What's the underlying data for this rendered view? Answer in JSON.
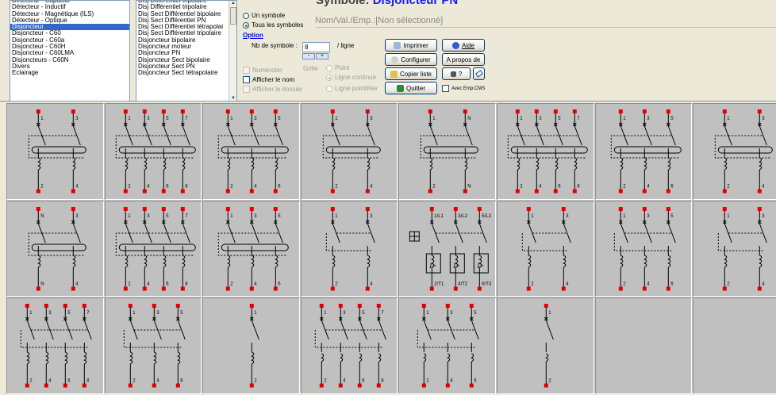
{
  "list1": {
    "items": [
      "Détecteur - Capacitif",
      "Détecteur - Inductif",
      "Détecteur - Magnétique (ILS)",
      "Détecteur - Optique",
      "Disjoncteur",
      "Disjoncteur - C60",
      "Disjoncteur - C60a",
      "Disjoncteur - C60H",
      "Disjoncteur - C60LMA",
      "Disjoncteurs - C60N",
      "Divers",
      "Eclairage"
    ],
    "selected_index": 4
  },
  "list2": {
    "items": [
      "Disj Différentiel tripolaire",
      "Disj Différentiel tripolaire",
      "Disj Sect Différentiel bipolaire",
      "Disj Sect Différentiel PN",
      "Disj Sect Différentiel tétrapolai",
      "Disj Sect Différentiel tripolaire",
      "Disjoncteur bipolaire",
      "Disjoncteur moteur",
      "Disjoncteur PN",
      "Disjoncteur Sect bipolaire",
      "Disjoncteur Sect PN",
      "Disjoncteur Sect tétrapolaire"
    ]
  },
  "mode": {
    "un_symbole": "Un symbole",
    "tous_symboles": "Tous les symboles"
  },
  "option": {
    "label": "Option",
    "nb_label": "Nb de symbole :",
    "nb_value": "8",
    "per_line": "/ ligne",
    "spin_down": "-",
    "spin_up": "+"
  },
  "checks": {
    "numeroter": "Numéroter",
    "afficher_nom": "Afficher le nom",
    "afficher_dossier": "Afficher le dossier",
    "avec_emp": "Avec Emp.CMS"
  },
  "grille": {
    "label": "Grille",
    "point": "Point",
    "ligne_continue": "Ligne continue",
    "ligne_pointillee": "Ligne pointillée"
  },
  "buttons": {
    "imprimer": "Imprimer",
    "configurer": "Configurer",
    "copier": "Copier liste",
    "quitter": "Quitter",
    "aide": "Aide",
    "apropos": "A propos de",
    "help_q": "?"
  },
  "header": {
    "symbole_label": "Symbole:",
    "symbole_value": "Disjoncteur PN",
    "nomval": "Nom/Val./Emp.:[Non sélectionné]"
  },
  "colors": {
    "selection": "#3169c6",
    "terminal": "#e00000",
    "title_value": "#1a1aff"
  },
  "symbols": [
    {
      "poles": 2,
      "labels_top": [
        "1",
        "3"
      ],
      "labels_bot": [
        "2",
        "4"
      ],
      "diff": true
    },
    {
      "poles": 4,
      "labels_top": [
        "1",
        "3",
        "5",
        "7"
      ],
      "labels_bot": [
        "2",
        "4",
        "6",
        "8"
      ],
      "diff": true
    },
    {
      "poles": 3,
      "labels_top": [
        "1",
        "3",
        "5"
      ],
      "labels_bot": [
        "2",
        "4",
        "6"
      ],
      "diff": true
    },
    {
      "poles": 2,
      "labels_top": [
        "1",
        "3"
      ],
      "labels_bot": [
        "2",
        "4"
      ],
      "diff": true
    },
    {
      "poles": 2,
      "labels_top": [
        "1",
        "N"
      ],
      "labels_bot": [
        "2",
        "N"
      ],
      "diff": true
    },
    {
      "poles": 4,
      "labels_top": [
        "1",
        "3",
        "5",
        "7"
      ],
      "labels_bot": [
        "2",
        "4",
        "6",
        "8"
      ],
      "diff": true
    },
    {
      "poles": 3,
      "labels_top": [
        "1",
        "3",
        "5"
      ],
      "labels_bot": [
        "2",
        "4",
        "6"
      ],
      "diff": true
    },
    {
      "poles": 2,
      "labels_top": [
        "1",
        "3"
      ],
      "labels_bot": [
        "2",
        "4"
      ],
      "diff": true
    },
    {
      "poles": 2,
      "labels_top": [
        "N",
        "3"
      ],
      "labels_bot": [
        "N",
        "4"
      ],
      "diff": true
    },
    {
      "poles": 4,
      "labels_top": [
        "1",
        "3",
        "5",
        "7"
      ],
      "labels_bot": [
        "2",
        "4",
        "6",
        "8"
      ],
      "diff": true
    },
    {
      "poles": 3,
      "labels_top": [
        "1",
        "3",
        "5"
      ],
      "labels_bot": [
        "2",
        "4",
        "6"
      ],
      "diff": true
    },
    {
      "poles": 2,
      "labels_top": [
        "1",
        "3"
      ],
      "labels_bot": [
        "2",
        "4"
      ],
      "diff": false
    },
    {
      "poles": 3,
      "labels_top": [
        "1/L1",
        "3/L2",
        "5/L3"
      ],
      "labels_bot": [
        "2/T1",
        "4/T2",
        "6/T3"
      ],
      "motor": true
    },
    {
      "poles": 2,
      "labels_top": [
        "1",
        "3"
      ],
      "labels_bot": [
        "2",
        "4"
      ],
      "diff": false
    },
    {
      "poles": 3,
      "labels_top": [
        "1",
        "3",
        "5"
      ],
      "labels_bot": [
        "2",
        "4",
        "6"
      ],
      "diff": false
    },
    {
      "poles": 2,
      "labels_top": [
        "1",
        "3"
      ],
      "labels_bot": [
        "2",
        "4"
      ],
      "diff": false
    },
    {
      "poles": 4,
      "labels_top": [
        "1",
        "3",
        "5",
        "7"
      ],
      "labels_bot": [
        "2",
        "4",
        "6",
        "8"
      ],
      "diff": false
    },
    {
      "poles": 3,
      "labels_top": [
        "1",
        "3",
        "5"
      ],
      "labels_bot": [
        "2",
        "4",
        "6"
      ],
      "diff": false
    },
    {
      "poles": 1,
      "labels_top": [
        "1"
      ],
      "labels_bot": [
        "2"
      ],
      "diff": false
    },
    {
      "poles": 4,
      "labels_top": [
        "1",
        "3",
        "5",
        "7"
      ],
      "labels_bot": [
        "2",
        "4",
        "6",
        "8"
      ],
      "diff": false,
      "plain": true
    },
    {
      "poles": 3,
      "labels_top": [
        "1",
        "3",
        "5"
      ],
      "labels_bot": [
        "2",
        "4",
        "6"
      ],
      "diff": false,
      "plain": true
    },
    {
      "poles": 1,
      "labels_top": [
        "1"
      ],
      "labels_bot": [
        "2"
      ],
      "diff": false,
      "plain": true
    }
  ]
}
